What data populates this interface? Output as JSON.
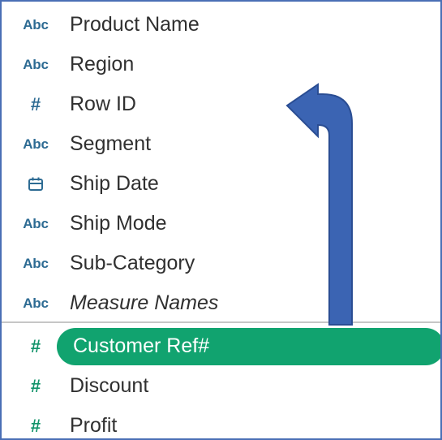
{
  "colors": {
    "dimension_icon": "#2d6b93",
    "measure_icon": "#12936a",
    "selected_pill": "#11a36f",
    "arrow_fill": "#3b64b3",
    "arrow_stroke": "#2a4d93",
    "frame_border": "#4a6fb5",
    "divider": "#c6c6c6"
  },
  "dimensions": [
    {
      "label": "Product Name",
      "type": "Abc",
      "icon": "string-type-icon"
    },
    {
      "label": "Region",
      "type": "Abc",
      "icon": "string-type-icon"
    },
    {
      "label": "Row ID",
      "type": "#",
      "icon": "number-type-icon"
    },
    {
      "label": "Segment",
      "type": "Abc",
      "icon": "string-type-icon"
    },
    {
      "label": "Ship Date",
      "type": "",
      "icon": "calendar-icon"
    },
    {
      "label": "Ship Mode",
      "type": "Abc",
      "icon": "string-type-icon"
    },
    {
      "label": "Sub-Category",
      "type": "Abc",
      "icon": "string-type-icon"
    },
    {
      "label": "Measure Names",
      "type": "Abc",
      "icon": "string-type-icon"
    }
  ],
  "measures": [
    {
      "label": "Customer Ref#",
      "type": "#",
      "icon": "number-type-icon",
      "selected": true
    },
    {
      "label": "Discount",
      "type": "#",
      "icon": "number-type-icon"
    },
    {
      "label": "Profit",
      "type": "#",
      "icon": "number-type-icon"
    }
  ],
  "annotation": {
    "icon": "curved-arrow-up-left-icon"
  }
}
